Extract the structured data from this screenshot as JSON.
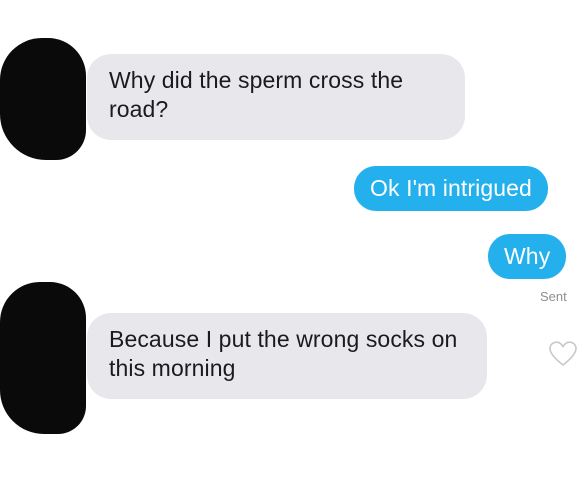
{
  "thread": {
    "messages": [
      {
        "direction": "incoming",
        "text": "Why did the sperm cross the road?"
      },
      {
        "direction": "outgoing",
        "text": "Ok I'm intrigued"
      },
      {
        "direction": "outgoing",
        "text": "Why"
      },
      {
        "direction": "incoming",
        "text": "Because I put the wrong socks on this morning"
      }
    ],
    "status": "Sent"
  },
  "colors": {
    "incoming_bubble": "#e8e8ec",
    "outgoing_bubble": "#23b0ec",
    "redaction": "#0a0a0a"
  },
  "icons": {
    "like": "heart-outline-icon",
    "avatar": "redacted-avatar"
  }
}
